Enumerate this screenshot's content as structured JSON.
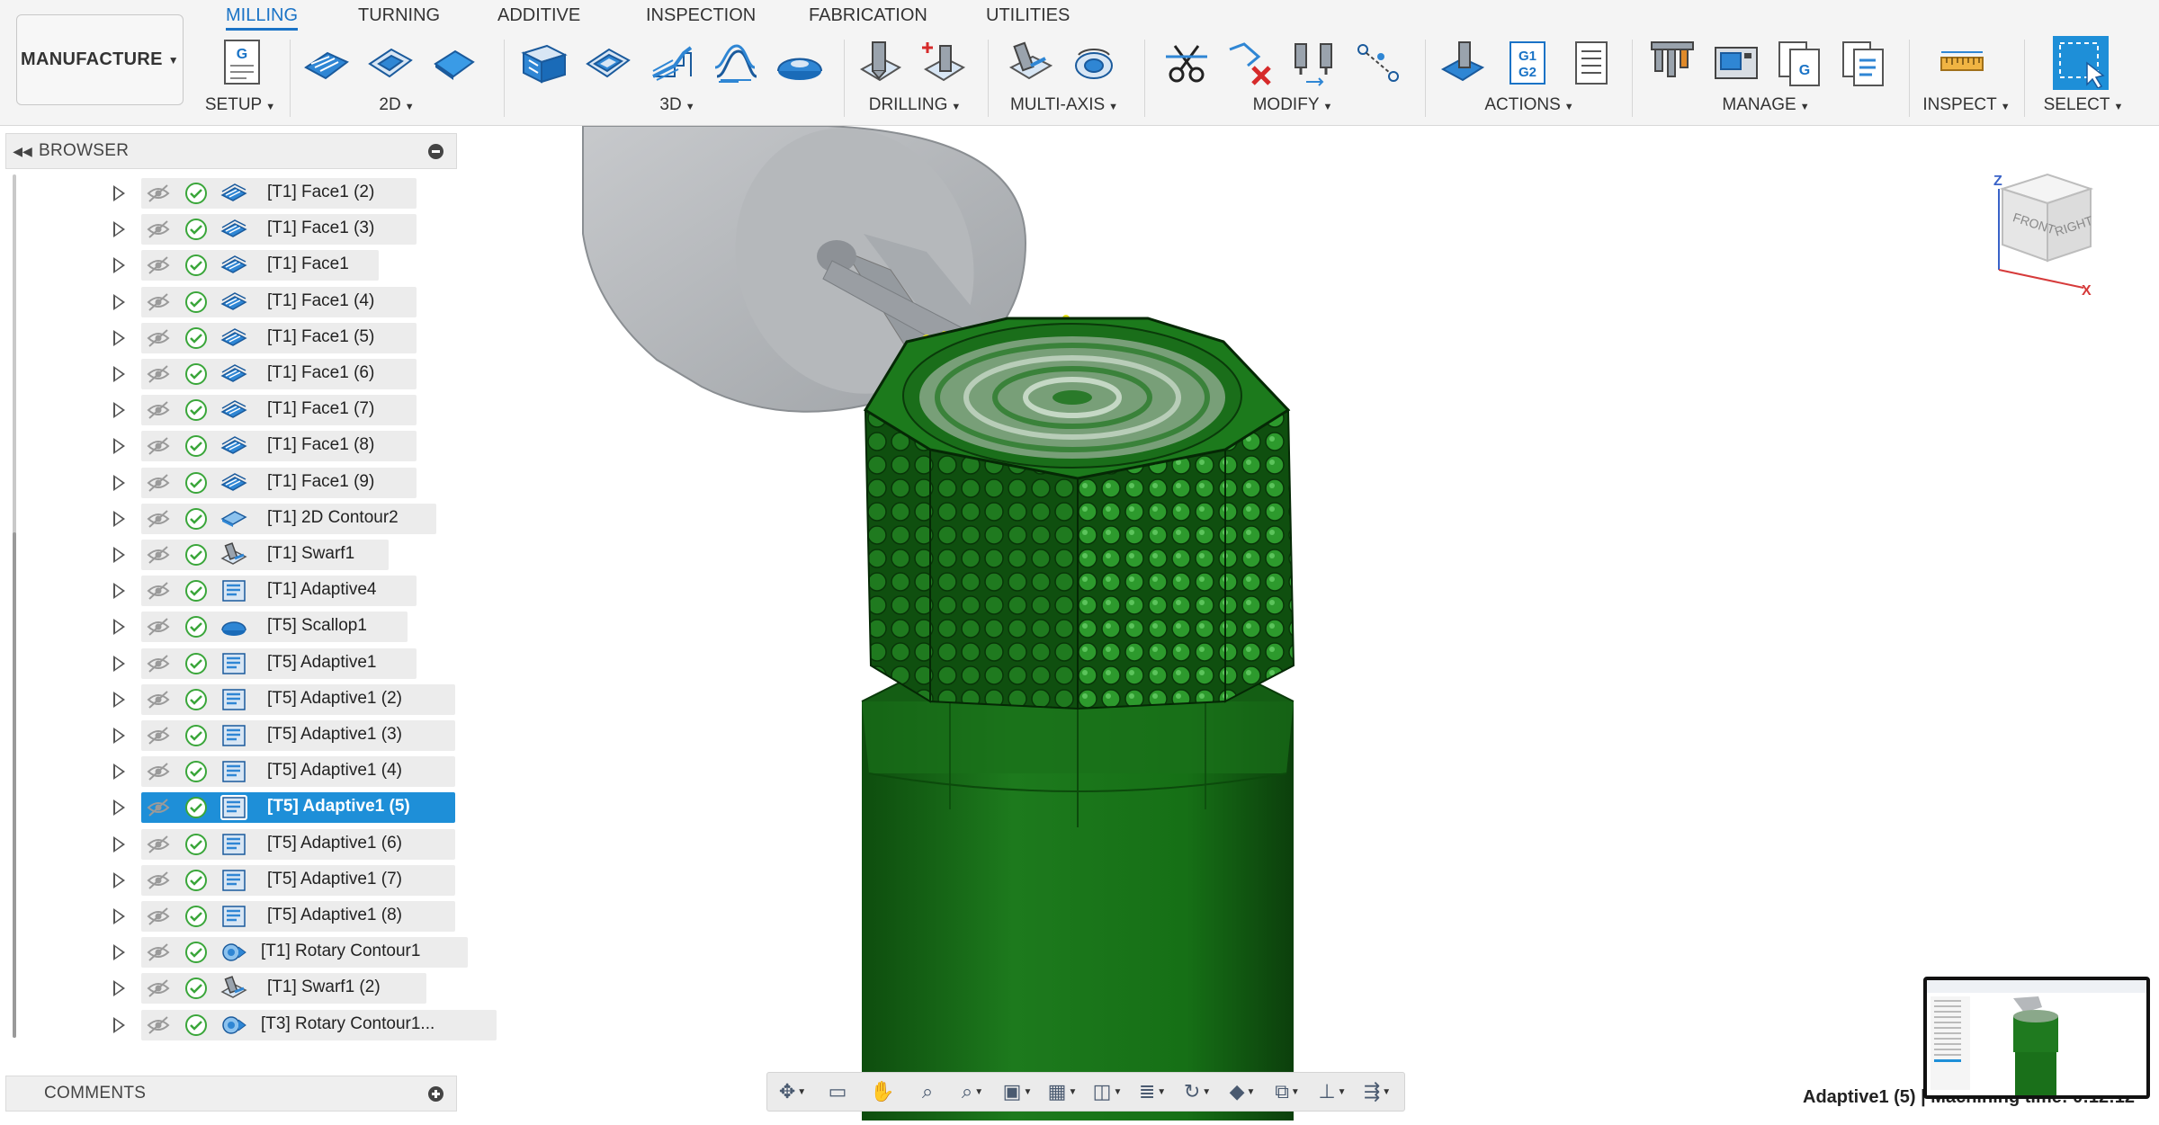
{
  "workspace": {
    "label": "MANUFACTURE"
  },
  "tabs": [
    {
      "label": "MILLING",
      "active": true
    },
    {
      "label": "TURNING"
    },
    {
      "label": "ADDITIVE"
    },
    {
      "label": "INSPECTION"
    },
    {
      "label": "FABRICATION"
    },
    {
      "label": "UTILITIES"
    }
  ],
  "groups": {
    "setup": "SETUP",
    "twod": "2D",
    "threed": "3D",
    "drilling": "DRILLING",
    "multiaxis": "MULTI-AXIS",
    "modify": "MODIFY",
    "actions": "ACTIONS",
    "manage": "MANAGE",
    "inspect": "INSPECT",
    "select": "SELECT"
  },
  "icon_text": {
    "g": "G",
    "g1": "G1",
    "g2": "G2"
  },
  "colors": {
    "accent": "#1a73c6",
    "selection": "#1e8fd8",
    "part_green": "#1f7a1f",
    "check_green": "#3aa63a"
  },
  "browser": {
    "title": "BROWSER",
    "items": [
      {
        "label": "[T1] Face1 (2)",
        "icon": "face-icon"
      },
      {
        "label": "[T1] Face1 (3)",
        "icon": "face-icon"
      },
      {
        "label": "[T1] Face1",
        "icon": "face-icon"
      },
      {
        "label": "[T1] Face1 (4)",
        "icon": "face-icon"
      },
      {
        "label": "[T1] Face1 (5)",
        "icon": "face-icon"
      },
      {
        "label": "[T1] Face1 (6)",
        "icon": "face-icon"
      },
      {
        "label": "[T1] Face1 (7)",
        "icon": "face-icon"
      },
      {
        "label": "[T1] Face1 (8)",
        "icon": "face-icon"
      },
      {
        "label": "[T1] Face1 (9)",
        "icon": "face-icon"
      },
      {
        "label": "[T1] 2D Contour2",
        "icon": "contour-2d-icon"
      },
      {
        "label": "[T1] Swarf1",
        "icon": "swarf-icon"
      },
      {
        "label": "[T1] Adaptive4",
        "icon": "adaptive-icon"
      },
      {
        "label": "[T5] Scallop1",
        "icon": "scallop-icon"
      },
      {
        "label": "[T5] Adaptive1",
        "icon": "adaptive-icon"
      },
      {
        "label": "[T5] Adaptive1 (2)",
        "icon": "adaptive-icon"
      },
      {
        "label": "[T5] Adaptive1 (3)",
        "icon": "adaptive-icon"
      },
      {
        "label": "[T5] Adaptive1 (4)",
        "icon": "adaptive-icon"
      },
      {
        "label": "[T5] Adaptive1 (5)",
        "icon": "adaptive-icon",
        "selected": true
      },
      {
        "label": "[T5] Adaptive1 (6)",
        "icon": "adaptive-icon"
      },
      {
        "label": "[T5] Adaptive1 (7)",
        "icon": "adaptive-icon"
      },
      {
        "label": "[T5] Adaptive1 (8)",
        "icon": "adaptive-icon"
      },
      {
        "label": "[T1] Rotary Contour1",
        "icon": "rotary-contour-icon"
      },
      {
        "label": "[T1] Swarf1 (2)",
        "icon": "swarf-icon"
      },
      {
        "label": "[T3] Rotary Contour1...",
        "icon": "rotary-contour-icon"
      }
    ]
  },
  "comments": {
    "title": "COMMENTS"
  },
  "viewcube": {
    "front": "FRONT",
    "right": "RIGHT",
    "z": "Z",
    "x": "X"
  },
  "status": {
    "text": "Adaptive1 (5) | Machining time: 0:12:12"
  }
}
